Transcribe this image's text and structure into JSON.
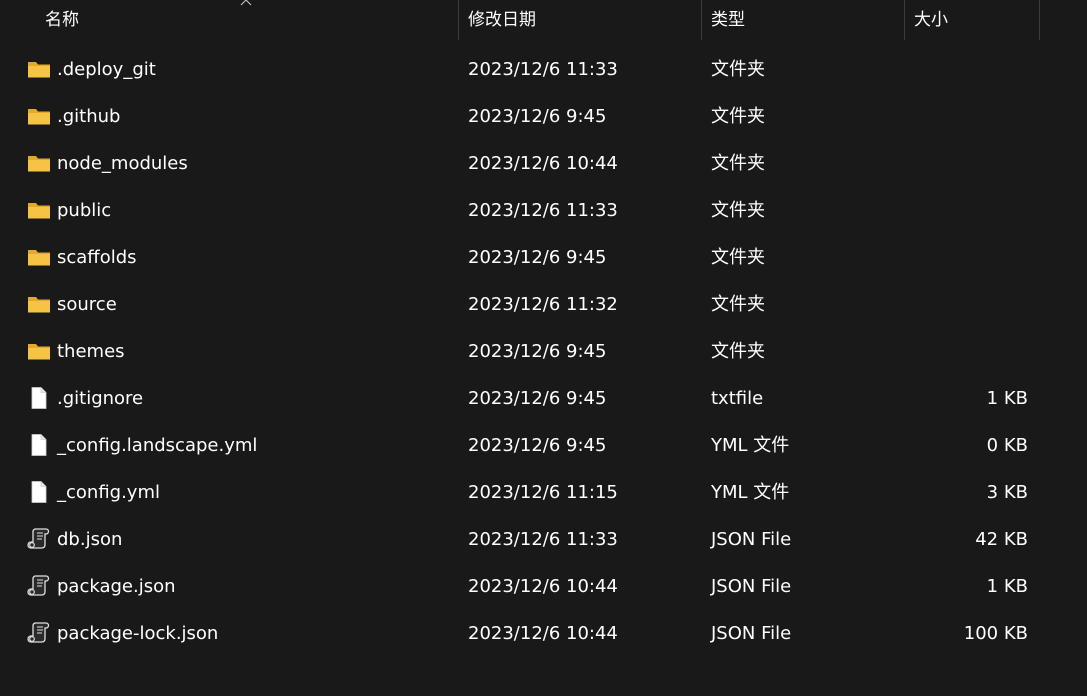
{
  "columns": {
    "name": "名称",
    "date": "修改日期",
    "type": "类型",
    "size": "大小"
  },
  "sort": {
    "column": "name",
    "direction": "ascending",
    "icon": "chevron-up-icon"
  },
  "colors": {
    "background": "#191919",
    "text": "#ffffff",
    "divider": "#3c3c3c",
    "folder": "#f6c445",
    "folder_dark": "#e4a92a"
  },
  "files": [
    {
      "icon": "folder-icon",
      "name": ".deploy_git",
      "date": "2023/12/6 11:33",
      "type": "文件夹",
      "size": ""
    },
    {
      "icon": "folder-icon",
      "name": ".github",
      "date": "2023/12/6 9:45",
      "type": "文件夹",
      "size": ""
    },
    {
      "icon": "folder-icon",
      "name": "node_modules",
      "date": "2023/12/6 10:44",
      "type": "文件夹",
      "size": ""
    },
    {
      "icon": "folder-icon",
      "name": "public",
      "date": "2023/12/6 11:33",
      "type": "文件夹",
      "size": ""
    },
    {
      "icon": "folder-icon",
      "name": "scaffolds",
      "date": "2023/12/6 9:45",
      "type": "文件夹",
      "size": ""
    },
    {
      "icon": "folder-icon",
      "name": "source",
      "date": "2023/12/6 11:32",
      "type": "文件夹",
      "size": ""
    },
    {
      "icon": "folder-icon",
      "name": "themes",
      "date": "2023/12/6 9:45",
      "type": "文件夹",
      "size": ""
    },
    {
      "icon": "file-icon",
      "name": ".gitignore",
      "date": "2023/12/6 9:45",
      "type": "txtfile",
      "size": "1 KB"
    },
    {
      "icon": "file-icon",
      "name": "_config.landscape.yml",
      "date": "2023/12/6 9:45",
      "type": "YML 文件",
      "size": "0 KB"
    },
    {
      "icon": "file-icon",
      "name": "_config.yml",
      "date": "2023/12/6 11:15",
      "type": "YML 文件",
      "size": "3 KB"
    },
    {
      "icon": "json-file-icon",
      "name": "db.json",
      "date": "2023/12/6 11:33",
      "type": "JSON File",
      "size": "42 KB"
    },
    {
      "icon": "json-file-icon",
      "name": "package.json",
      "date": "2023/12/6 10:44",
      "type": "JSON File",
      "size": "1 KB"
    },
    {
      "icon": "json-file-icon",
      "name": "package-lock.json",
      "date": "2023/12/6 10:44",
      "type": "JSON File",
      "size": "100 KB"
    }
  ]
}
